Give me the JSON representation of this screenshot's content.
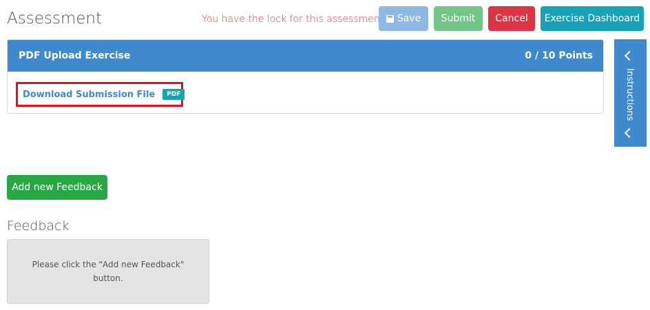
{
  "header": {
    "title": "Assessment",
    "lock_message": "You have the lock for this assessment"
  },
  "toolbar": {
    "save_label": "Save",
    "submit_label": "Submit",
    "cancel_label": "Cancel",
    "dashboard_label": "Exercise Dashboard"
  },
  "exercise": {
    "title": "PDF Upload Exercise",
    "points": "0 / 10 Points",
    "download_label": "Download Submission File",
    "file_badge": "PDF"
  },
  "instructions_panel": {
    "label": "Instructions"
  },
  "feedback": {
    "add_label": "Add new Feedback",
    "title": "Feedback",
    "empty_message": "Please click the \"Add new Feedback\" button."
  },
  "colors": {
    "primary": "#3e8acc",
    "danger": "#dc3545",
    "success": "#28a745",
    "info": "#17a2b8",
    "highlight": "#e0101a"
  }
}
